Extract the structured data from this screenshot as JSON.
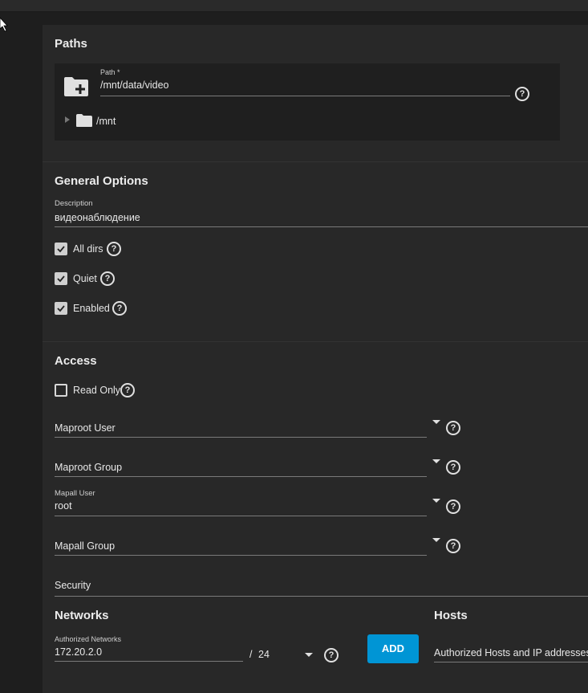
{
  "paths": {
    "title": "Paths",
    "path_label": "Path *",
    "path_value": "/mnt/data/video",
    "tree_root": "/mnt"
  },
  "general": {
    "title": "General Options",
    "description_label": "Description",
    "description_value": "видеонаблюдение",
    "all_dirs": {
      "label": "All dirs",
      "checked": true
    },
    "quiet": {
      "label": "Quiet",
      "checked": true
    },
    "enabled": {
      "label": "Enabled",
      "checked": true
    }
  },
  "access": {
    "title": "Access",
    "read_only": {
      "label": "Read Only",
      "checked": false
    },
    "maproot_user": "Maproot User",
    "maproot_group": "Maproot Group",
    "mapall_user_label": "Mapall User",
    "mapall_user_value": "root",
    "mapall_group": "Mapall Group",
    "security": "Security"
  },
  "networks": {
    "title": "Networks",
    "auth_label": "Authorized Networks",
    "network_value": "172.20.2.0",
    "separator": "/",
    "mask_value": "24",
    "add_label": "ADD"
  },
  "hosts": {
    "title": "Hosts",
    "placeholder": "Authorized Hosts and IP addresses"
  },
  "icons": {
    "help": "help-circle-icon",
    "folder_add": "folder-plus-icon",
    "folder": "folder-icon"
  },
  "colors": {
    "accent": "#0095d5",
    "panel": "#282828",
    "background": "#1e1e1e"
  }
}
